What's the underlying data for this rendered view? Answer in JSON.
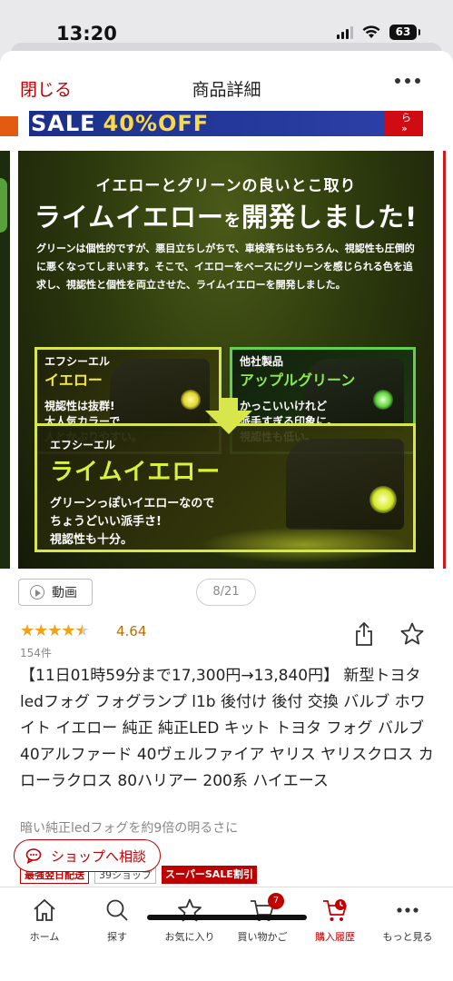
{
  "status_bar": {
    "time": "13:20",
    "battery": "63"
  },
  "header": {
    "close_label": "閉じる",
    "title": "商品詳細"
  },
  "sale_banner": {
    "text": "SALE",
    "discount_text": "40%OFF",
    "side_text": "ら\n»"
  },
  "slide": {
    "heading": "イエローとグリーンの良いとこ取り",
    "title_main": "ライムイエロー",
    "title_small": "を",
    "title_end": "開発しました!",
    "body": "グリーンは個性的ですが、悪目立ちしがちで、車検落ちはもちろん、視認性も圧倒的に悪くなってしまいます。そこで、イエローをベースにグリーンを感じられる色を追求し、視認性と個性を両立させた、ライムイエローを開発しました。",
    "box_yellow": {
      "label": "エフシーエル",
      "name": "イエロー",
      "desc": "視認性は抜群!\n大人気カラーで\n人とかぶりやすい。"
    },
    "box_green": {
      "label": "他社製品",
      "name": "アップルグリーン",
      "desc": "かっこいいけれど\n派手すぎる印象に。\n視認性も低い。"
    },
    "box_lime": {
      "label": "エフシーエル",
      "name": "ライムイエロー",
      "desc": "グリーンっぽいイエローなので\nちょうどいい派手さ!\n視認性も十分。"
    }
  },
  "media": {
    "video_label": "動画",
    "page_counter": "8/21"
  },
  "rating": {
    "value": "4.64",
    "stars": 4.64,
    "review_count": "154件"
  },
  "product": {
    "title": "【11日01時59分まで17,300円→13,840円】 新型トヨタ ledフォグ フォグランプ l1b 後付け 後付 交換 バルブ ホワイト イエロー 純正 純正LED キット トヨタ フォグ バルブ 40アルファード 40ヴェルファイア ヤリス ヤリスクロス カローラクロス 80ハリアー 200系 ハイエース",
    "subtitle": "暗い純正ledフォグを約9倍の明るさに"
  },
  "shop_consult_label": "ショップへ相談",
  "badges": [
    "最強翌日配送",
    "39ショップ",
    "スーパーSALE割引"
  ],
  "tabbar": {
    "cart_count": "7",
    "items": [
      {
        "label": "ホーム",
        "icon": "home-icon"
      },
      {
        "label": "探す",
        "icon": "search-icon"
      },
      {
        "label": "お気に入り",
        "icon": "star-icon"
      },
      {
        "label": "買い物かご",
        "icon": "cart-icon"
      },
      {
        "label": "購入履歴",
        "icon": "purchase-history-icon"
      },
      {
        "label": "もっと見る",
        "icon": "more-icon"
      }
    ]
  },
  "colors": {
    "accent": "#bf0000",
    "star": "#f2a216",
    "lime": "#d7e64a"
  }
}
